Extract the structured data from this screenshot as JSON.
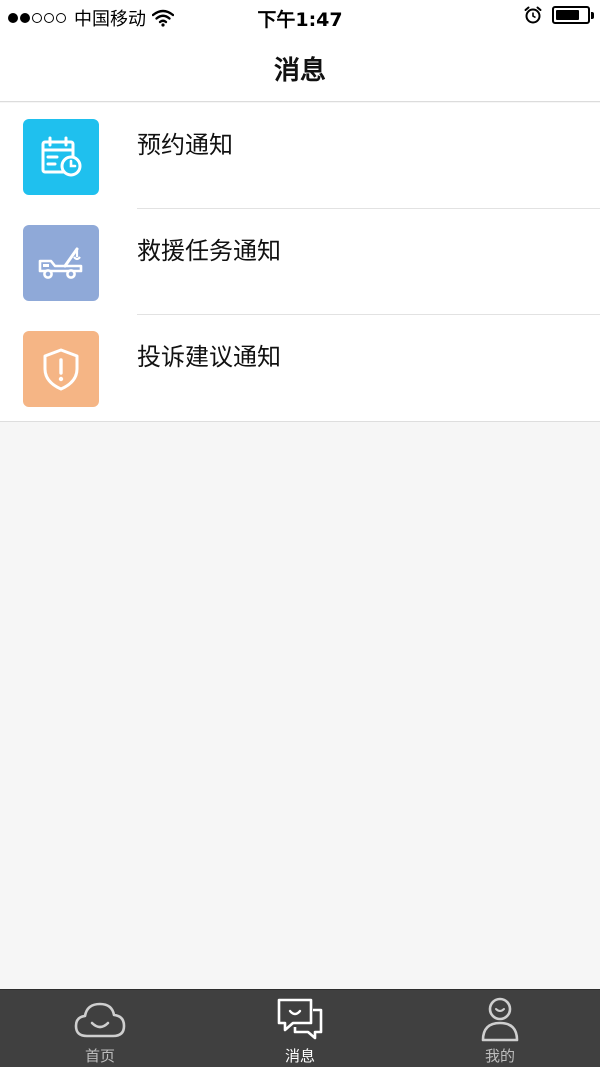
{
  "status_bar": {
    "carrier": "中国移动",
    "time": "下午1:47",
    "signal_bars_filled": 2,
    "signal_bars_total": 5,
    "battery_level": 0.75
  },
  "nav": {
    "title": "消息"
  },
  "messages": [
    {
      "label": "预约通知",
      "icon": "calendar-clock-icon",
      "color": "#1fc0ee"
    },
    {
      "label": "救援任务通知",
      "icon": "tow-truck-icon",
      "color": "#8fa9d8"
    },
    {
      "label": "投诉建议通知",
      "icon": "shield-alert-icon",
      "color": "#f5b585"
    }
  ],
  "tabs": [
    {
      "label": "首页",
      "icon": "cloud-smile-icon",
      "active": false
    },
    {
      "label": "消息",
      "icon": "chat-bubbles-icon",
      "active": true
    },
    {
      "label": "我的",
      "icon": "person-icon",
      "active": false
    }
  ],
  "colors": {
    "background": "#f6f6f6",
    "tab_bar": "#404040"
  }
}
